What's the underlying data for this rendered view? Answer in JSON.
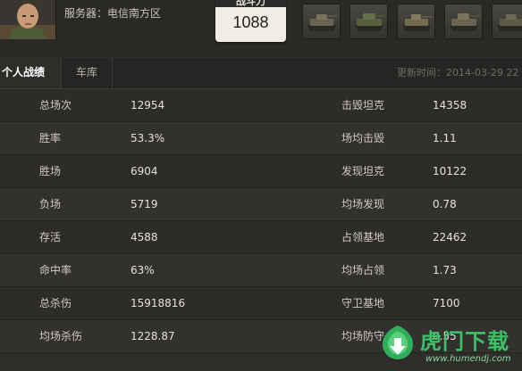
{
  "header": {
    "server_label": "服务器：电信南方区",
    "combat_power_title": "战斗力",
    "combat_power_value": "1088",
    "tank_icons": [
      "tank-icon",
      "tank-icon",
      "tank-icon",
      "tank-icon",
      "tank-icon"
    ]
  },
  "tabs": {
    "personal_stats": "个人战绩",
    "garage": "车库",
    "update_time": "更新时间：2014-03-29 22"
  },
  "stats": [
    {
      "label_left": "总场次",
      "value_left": "12954",
      "label_right": "击毁坦克",
      "value_right": "14358"
    },
    {
      "label_left": "胜率",
      "value_left": "53.3%",
      "label_right": "场均击毁",
      "value_right": "1.11"
    },
    {
      "label_left": "胜场",
      "value_left": "6904",
      "label_right": "发现坦克",
      "value_right": "10122"
    },
    {
      "label_left": "负场",
      "value_left": "5719",
      "label_right": "均场发现",
      "value_right": "0.78"
    },
    {
      "label_left": "存活",
      "value_left": "4588",
      "label_right": "占领基地",
      "value_right": "22462"
    },
    {
      "label_left": "命中率",
      "value_left": "63%",
      "label_right": "均场占领",
      "value_right": "1.73"
    },
    {
      "label_left": "总杀伤",
      "value_left": "15918816",
      "label_right": "守卫基地",
      "value_right": "7100"
    },
    {
      "label_left": "均场杀伤",
      "value_left": "1228.87",
      "label_right": "均场防守",
      "value_right": "0.55"
    }
  ],
  "watermark": {
    "text": "虎门下载",
    "url": "www.humendj.com"
  },
  "colors": {
    "background": "#2e2d2a",
    "watermark_green": "#3ec06a"
  }
}
